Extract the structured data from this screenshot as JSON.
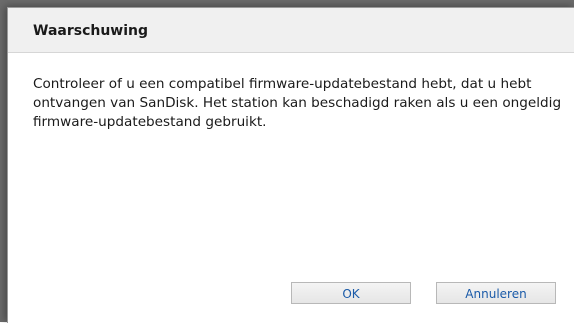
{
  "dialog": {
    "title": "Waarschuwing",
    "message": "Controleer of u een compatibel firmware-updatebestand hebt, dat u hebt ontvangen van SanDisk. Het station kan beschadigd raken als u een ongeldig firmware-updatebestand gebruikt.",
    "ok_label": "OK",
    "cancel_label": "Annuleren"
  },
  "colors": {
    "header_bg": "#f0f0f0",
    "button_text": "#1a5aa8"
  }
}
